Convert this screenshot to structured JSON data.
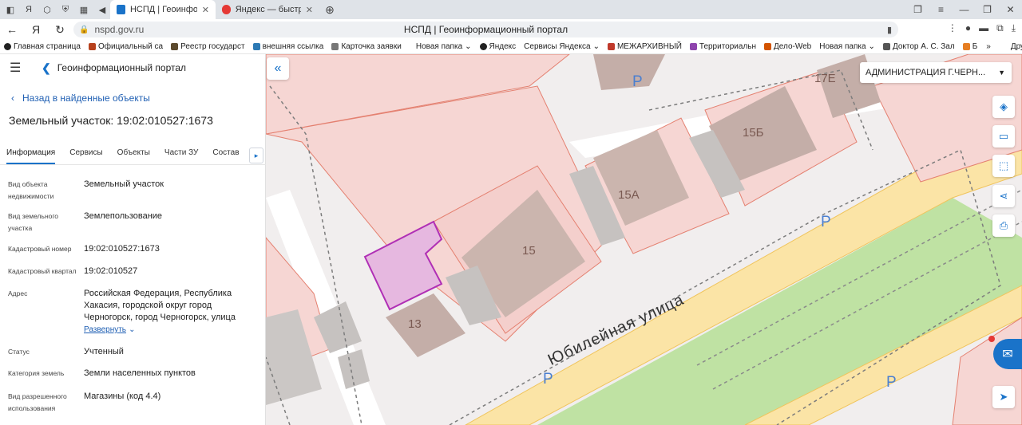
{
  "browser": {
    "tabs": [
      {
        "label": "НСПД | Геоинформационный портал",
        "active": true
      },
      {
        "label": "Яндекс — быстрый поиск",
        "active": false
      }
    ],
    "url_host": "nspd.gov.ru",
    "page_title": "НСПД | Геоинформационный портал"
  },
  "bookmarks": [
    {
      "label": "Главная страница",
      "color": "#222222"
    },
    {
      "label": "Официальный са",
      "color": "#b7411d"
    },
    {
      "label": "Реестр государст",
      "color": "#5c4a2e"
    },
    {
      "label": "внешняя ссылка",
      "color": "#2d7ab5"
    },
    {
      "label": "Карточка заявки",
      "color": "#777777"
    },
    {
      "label": "Новая папка",
      "color": ""
    },
    {
      "label": "Яндекс",
      "color": "#222222"
    },
    {
      "label": "Сервисы Яндекса",
      "color": ""
    },
    {
      "label": "МЕЖАРХИВНЫЙ",
      "color": "#c0392b"
    },
    {
      "label": "Территориальн",
      "color": "#8e44ad"
    },
    {
      "label": "Дело-Web",
      "color": "#d35400"
    },
    {
      "label": "Новая папка",
      "color": ""
    },
    {
      "label": "Доктор А. С. Зал",
      "color": "#555555"
    },
    {
      "label": "Б",
      "color": "#e67e22"
    },
    {
      "label": "Другие закладки",
      "color": ""
    }
  ],
  "portal": {
    "name": "Геоинформационный портал"
  },
  "back_link": "Назад в найденные объекты",
  "object_title": "Земельный участок: 19:02:010527:1673",
  "info_tabs": [
    "Информация",
    "Сервисы",
    "Объекты",
    "Части ЗУ",
    "Состав"
  ],
  "props": [
    {
      "key": "Вид объекта недвижимости",
      "value": "Земельный участок"
    },
    {
      "key": "Вид земельного участка",
      "value": "Землепользование"
    },
    {
      "key": "Кадастровый номер",
      "value": "19:02:010527:1673"
    },
    {
      "key": "Кадастровый квартал",
      "value": "19:02:010527"
    },
    {
      "key": "Адрес",
      "value": "Российская Федерация, Республика Хакасия, городской округ город Черногорск, город Черногорск, улица"
    },
    {
      "key": "Статус",
      "value": "Учтенный"
    },
    {
      "key": "Категория земель",
      "value": "Земли населенных пунктов"
    },
    {
      "key": "Вид разрешенного использования",
      "value": "Магазины (код 4.4)"
    }
  ],
  "expand_label": "Развернуть",
  "map": {
    "admin_select": "АДМИНИСТРАЦИЯ Г.ЧЕРН...",
    "street_label": "Юбилейная улица",
    "building_labels": [
      "15",
      "15А",
      "15Б",
      "17Е",
      "13"
    ],
    "parking_label": "P",
    "chat_badge": "1",
    "accent": "#1a73c9",
    "selected_parcel": "#b02fb5"
  }
}
